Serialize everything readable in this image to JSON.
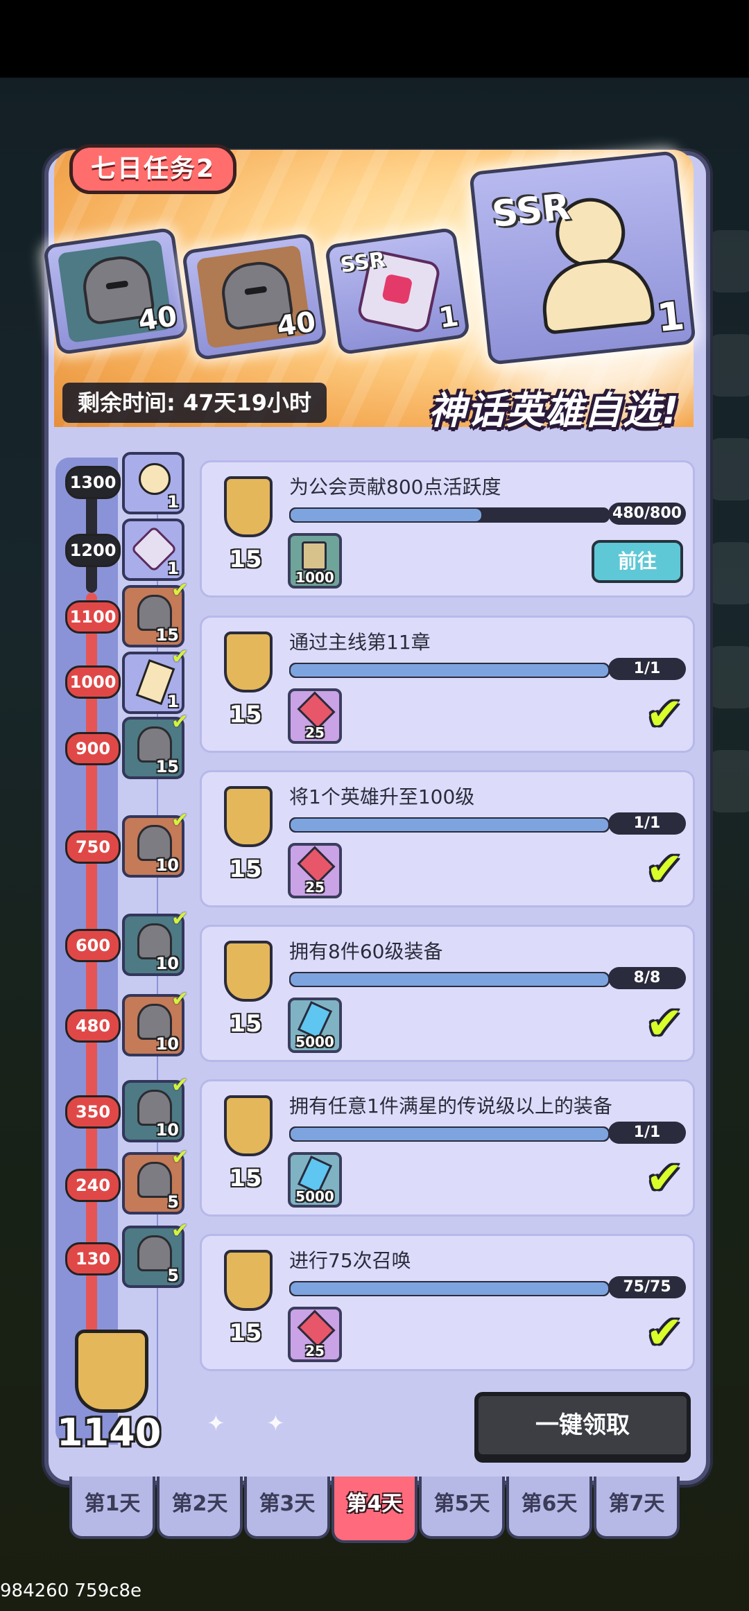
{
  "header": {
    "title": "七日任务2",
    "timer": "剩余时间: 47天19小时",
    "slogan": "神话英雄自选!",
    "rewards": [
      {
        "icon": "silver-helmet-book-icon",
        "qty": "40"
      },
      {
        "icon": "gold-helmet-book-icon",
        "qty": "40"
      },
      {
        "icon": "ssr-dice-icon",
        "qty": "1"
      },
      {
        "icon": "ssr-hero-select-icon",
        "qty": "1"
      }
    ]
  },
  "milestones": [
    {
      "points": "1300",
      "icon": "ssr-hero-select-icon",
      "qty": "1",
      "claimed": false
    },
    {
      "points": "1200",
      "icon": "ssr-dice-icon",
      "qty": "1",
      "claimed": false
    },
    {
      "points": "1100",
      "icon": "gold-helmet-book-icon",
      "qty": "15",
      "claimed": true
    },
    {
      "points": "1000",
      "icon": "ssr-hero-shard-icon",
      "qty": "1",
      "claimed": true
    },
    {
      "points": "900",
      "icon": "silver-helmet-book-icon",
      "qty": "15",
      "claimed": true
    },
    {
      "points": "750",
      "icon": "gold-helmet-book-icon",
      "qty": "10",
      "claimed": true
    },
    {
      "points": "600",
      "icon": "silver-helmet-book-icon",
      "qty": "10",
      "claimed": true
    },
    {
      "points": "480",
      "icon": "gold-helmet-book-icon",
      "qty": "10",
      "claimed": true
    },
    {
      "points": "350",
      "icon": "silver-helmet-book-icon",
      "qty": "10",
      "claimed": true
    },
    {
      "points": "240",
      "icon": "gold-helmet-book-icon",
      "qty": "5",
      "claimed": true
    },
    {
      "points": "130",
      "icon": "silver-helmet-book-icon",
      "qty": "5",
      "claimed": true
    }
  ],
  "total_points": "1140",
  "tasks": [
    {
      "title": "为公会贡献800点活跃度",
      "points": "15",
      "count": "480/800",
      "progress": 0.6,
      "reward_icon": "guild-card-icon",
      "reward_qty": "1000",
      "state": "go",
      "go_label": "前往"
    },
    {
      "title": "通过主线第11章",
      "points": "15",
      "count": "1/1",
      "progress": 1,
      "reward_icon": "ruby-gem-icon",
      "reward_qty": "25",
      "state": "done"
    },
    {
      "title": "将1个英雄升至100级",
      "points": "15",
      "count": "1/1",
      "progress": 1,
      "reward_icon": "ruby-gem-icon",
      "reward_qty": "25",
      "state": "done"
    },
    {
      "title": "拥有8件60级装备",
      "points": "15",
      "count": "8/8",
      "progress": 1,
      "reward_icon": "blue-crystal-icon",
      "reward_qty": "5000",
      "state": "done"
    },
    {
      "title": "拥有任意1件满星的传说级以上的装备",
      "points": "15",
      "count": "1/1",
      "progress": 1,
      "reward_icon": "blue-crystal-icon",
      "reward_qty": "5000",
      "state": "done"
    },
    {
      "title": "进行75次召唤",
      "points": "15",
      "count": "75/75",
      "progress": 1,
      "reward_icon": "ruby-gem-icon",
      "reward_qty": "25",
      "state": "done"
    }
  ],
  "claim_all_label": "一键领取",
  "tabs": [
    "第1天",
    "第2天",
    "第3天",
    "第4天",
    "第5天",
    "第6天",
    "第7天"
  ],
  "active_tab": 3,
  "footer_text": "984260 759c8e",
  "colors": {
    "accent_red": "#ff6b7c",
    "check_green": "#d9ff2a",
    "go_button": "#5fc8d6",
    "progress_fill": "#7ea4e0"
  }
}
